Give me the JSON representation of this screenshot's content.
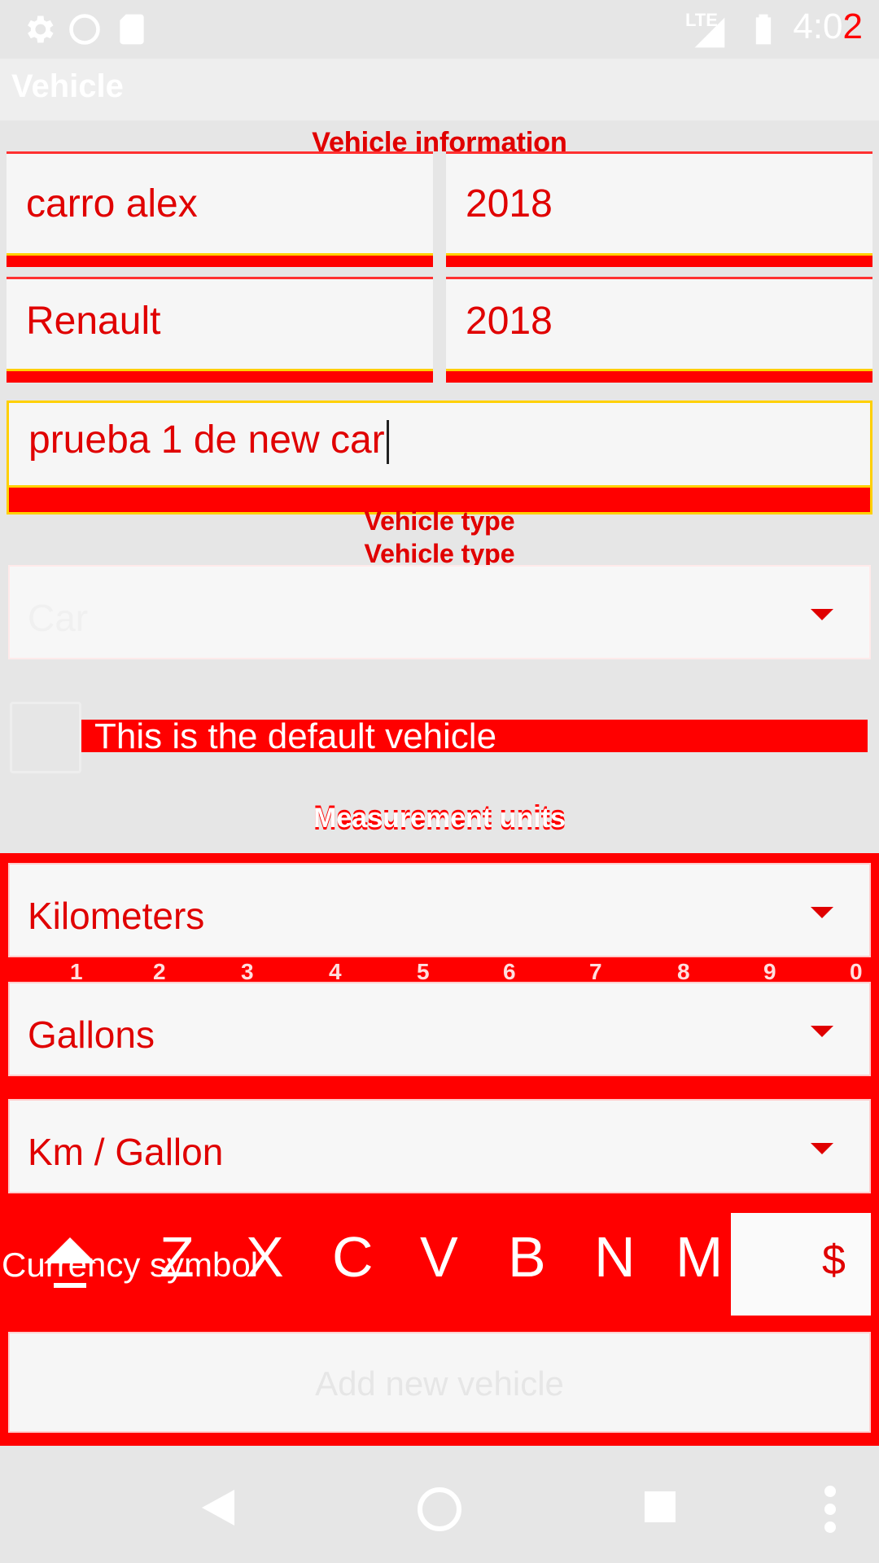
{
  "status_bar": {
    "time_main": "4:0",
    "time_last": "2",
    "network": "LTE"
  },
  "app_bar": {
    "title": "Vehicle"
  },
  "vehicle_information": {
    "section_title": "Vehicle information",
    "name_value": "carro alex",
    "year_value": "2018",
    "brand_value": "Renault",
    "model_value": "2018",
    "description_value": "prueba 1 de new car"
  },
  "vehicle_type": {
    "label_1": "Vehicle type",
    "label_2": "Vehicle type",
    "selected": "Car"
  },
  "default_vehicle": {
    "label": "This is the default vehicle"
  },
  "measurement_units": {
    "section_title": "Measurement units",
    "distance": "Kilometers",
    "volume": "Gallons",
    "efficiency": "Km / Gallon"
  },
  "keyboard": {
    "number_row": [
      "1",
      "2",
      "3",
      "4",
      "5",
      "6",
      "7",
      "8",
      "9",
      "0"
    ],
    "letter_row": [
      "Z",
      "X",
      "C",
      "V",
      "B",
      "N",
      "M"
    ]
  },
  "currency": {
    "label": "Currency symbol",
    "value": "$"
  },
  "add_button": {
    "label": "Add new vehicle"
  },
  "colors": {
    "accent": "#ff0000",
    "background": "#e6e6e6"
  }
}
